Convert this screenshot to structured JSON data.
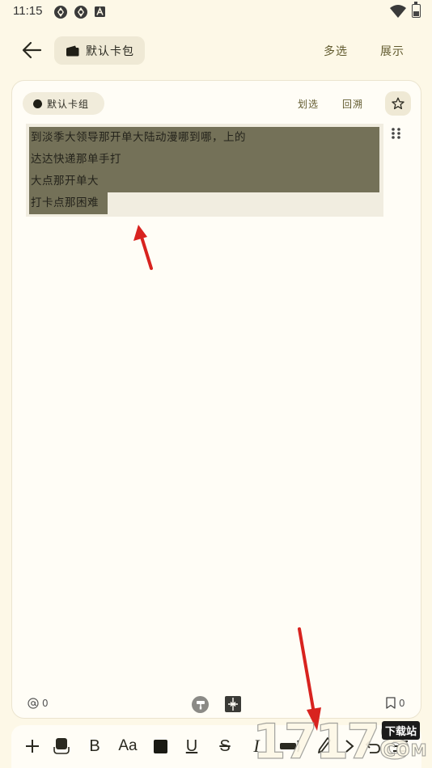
{
  "status_bar": {
    "time": "11:15"
  },
  "header": {
    "deck_name": "默认卡包",
    "multi_select": "多选",
    "display": "展示"
  },
  "card": {
    "group_name": "默认卡组",
    "select_action": "划选",
    "trace_action": "回溯",
    "lines": [
      "到淡季大领导那开单大陆动漫哪到哪，上的",
      "达达快递那单手打",
      "大点那开单大",
      "打卡点那困难"
    ],
    "mention_count": "0",
    "bookmark_count": "0"
  },
  "toolbar": {
    "bold": "B",
    "font_size": "Aa",
    "underline": "U",
    "strike": "S",
    "italic": "I"
  },
  "watermark": {
    "brand": "17178",
    "tag": "下载站",
    "domain": "COM"
  }
}
